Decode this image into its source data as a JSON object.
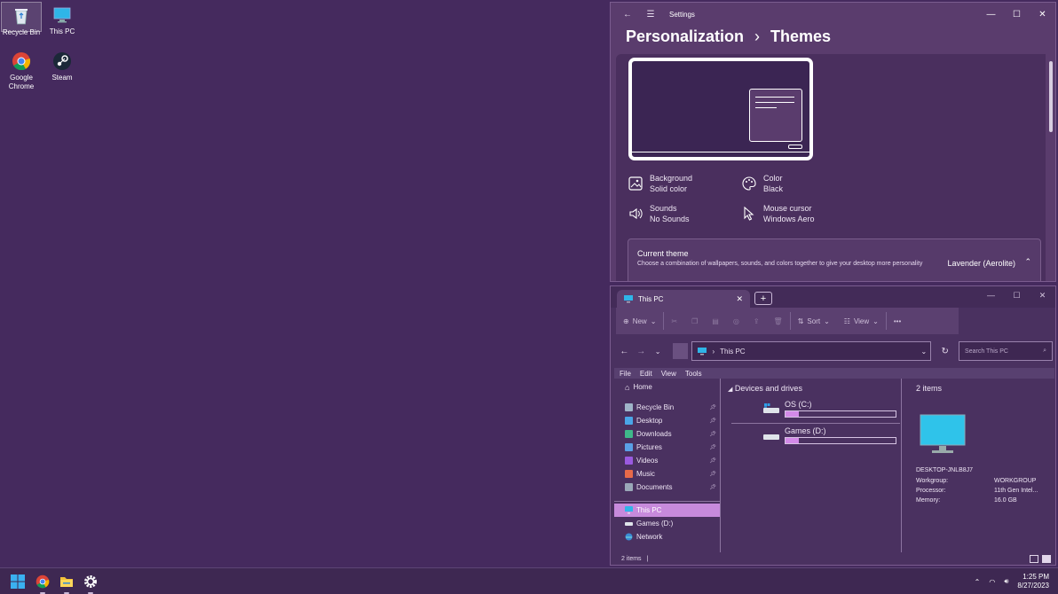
{
  "desktop": {
    "icons": [
      {
        "label": "Recycle Bin"
      },
      {
        "label": "This PC"
      },
      {
        "label": "Google Chrome"
      },
      {
        "label": "Steam"
      }
    ]
  },
  "settings": {
    "app_title": "Settings",
    "breadcrumb": {
      "parent": "Personalization",
      "separator": "›",
      "current": "Themes"
    },
    "options": [
      {
        "title": "Background",
        "value": "Solid color",
        "icon": "image-icon"
      },
      {
        "title": "Color",
        "value": "Black",
        "icon": "palette-icon"
      },
      {
        "title": "Sounds",
        "value": "No Sounds",
        "icon": "speaker-icon"
      },
      {
        "title": "Mouse cursor",
        "value": "Windows Aero",
        "icon": "cursor-icon"
      }
    ],
    "current_theme": {
      "title": "Current theme",
      "description": "Choose a combination of wallpapers, sounds, and colors together to give your desktop more personality",
      "value": "Lavender (Aerolite)"
    }
  },
  "explorer": {
    "tab_title": "This PC",
    "commands": {
      "new": "New",
      "sort": "Sort",
      "view": "View"
    },
    "address": "This PC",
    "search_placeholder": "Search This PC",
    "menu": [
      "File",
      "Edit",
      "View",
      "Tools"
    ],
    "nav": {
      "home": "Home",
      "pinned": [
        {
          "label": "Recycle Bin",
          "color": "#9fb4c8"
        },
        {
          "label": "Desktop",
          "color": "#4aa6e8"
        },
        {
          "label": "Downloads",
          "color": "#3fb88a"
        },
        {
          "label": "Pictures",
          "color": "#5aa0e6"
        },
        {
          "label": "Videos",
          "color": "#9a5ae0"
        },
        {
          "label": "Music",
          "color": "#e86a4a"
        },
        {
          "label": "Documents",
          "color": "#9aa8b8"
        }
      ],
      "this_pc": "This PC",
      "games": "Games (D:)",
      "network": "Network"
    },
    "section_title": "Devices and drives",
    "drives": [
      {
        "name": "OS (C:)",
        "used_fraction": 0.12
      },
      {
        "name": "Games (D:)",
        "used_fraction": 0.12
      }
    ],
    "details": {
      "count": "2 items",
      "pc_name": "DESKTOP-JNLB8J7",
      "rows": [
        {
          "k": "Workgroup:",
          "v": "WORKGROUP"
        },
        {
          "k": "Processor:",
          "v": "11th Gen Intel..."
        },
        {
          "k": "Memory:",
          "v": "16.0 GB"
        }
      ]
    },
    "status": "2 items"
  },
  "taskbar": {
    "time": "1:25 PM",
    "date": "8/27/2023"
  },
  "colors": {
    "desktop": "#452a5e",
    "accent": "#c78adc"
  }
}
